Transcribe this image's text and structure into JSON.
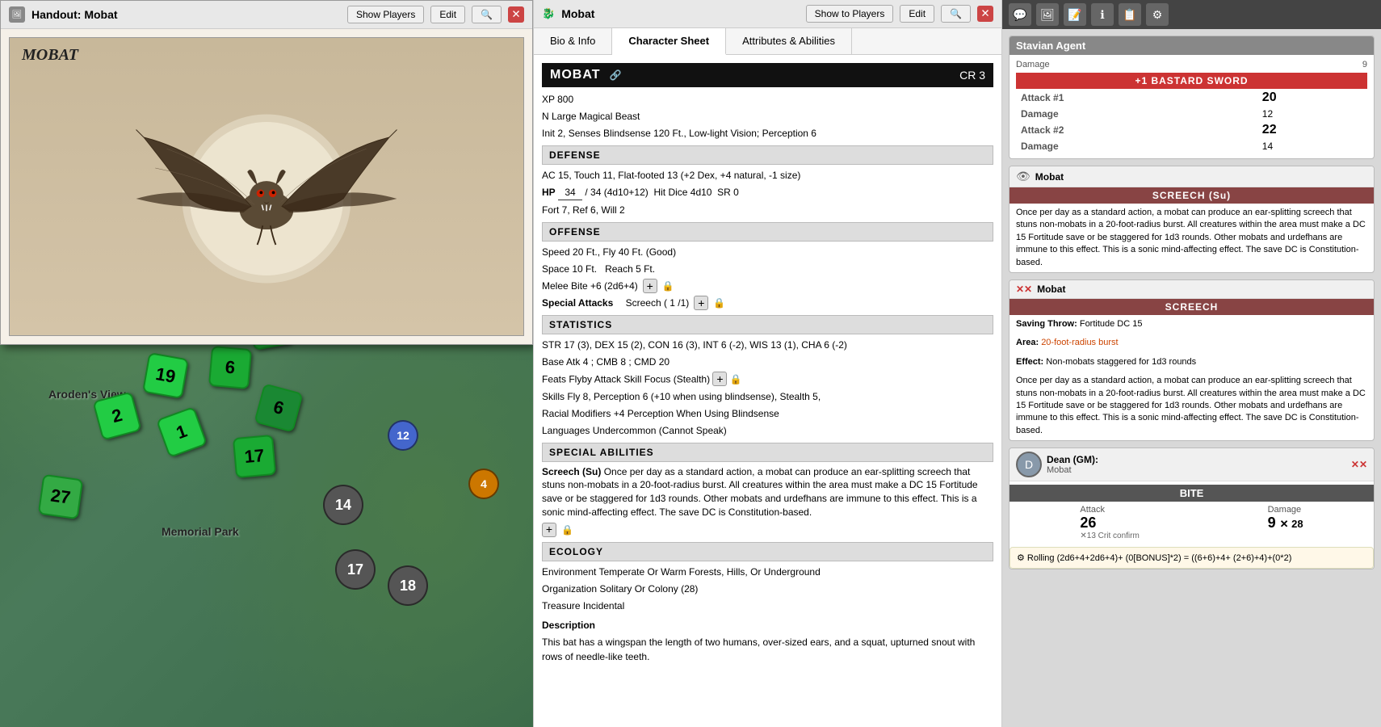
{
  "handout": {
    "title": "Handout: Mobat",
    "show_players_label": "Show Players",
    "edit_label": "Edit",
    "search_icon": "🔍",
    "image_title": "MOBAT",
    "image_alt": "Mobat - large bat creature"
  },
  "char_panel": {
    "title": "Mobat",
    "show_to_players_label": "Show to Players",
    "edit_label": "Edit",
    "search_icon": "🔍",
    "tabs": [
      {
        "id": "bio",
        "label": "Bio & Info"
      },
      {
        "id": "sheet",
        "label": "Character Sheet",
        "active": true
      },
      {
        "id": "attrs",
        "label": "Attributes & Abilities"
      }
    ],
    "creature": {
      "name": "MOBAT",
      "cr": "CR 3",
      "xp": "XP 800",
      "type": "N Large Magical Beast",
      "init": "Init 2",
      "senses": "Senses Blindsense 120 Ft., Low-light Vision; Perception 6",
      "defense_header": "DEFENSE",
      "ac": "AC 15, Touch 11, Flat-footed 13 (+2 Dex, +4 natural, -1 size)",
      "hp_label": "HP",
      "hp_current": "34",
      "hp_max": "34 (4d10+12)",
      "hit_dice": "Hit Dice 4d10",
      "sr": "SR 0",
      "fort": "Fort 7",
      "ref": "Ref 6",
      "will": "Will 2",
      "offense_header": "OFFENSE",
      "speed": "Speed 20 Ft., Fly 40 Ft. (Good)",
      "space": "Space 10 Ft.",
      "reach": "Reach 5 Ft.",
      "melee": "Melee    Bite +6 (2d6+4)",
      "special_attacks_label": "Special Attacks",
      "special_attacks_value": "Screech ( 1 /1)",
      "statistics_header": "STATISTICS",
      "str": "STR 17 (3)",
      "dex": "DEX 15 (2)",
      "con": "CON 16 (3)",
      "int": "INT 6 (-2)",
      "wis": "WIS 13 (1)",
      "cha": "CHA 6 (-2)",
      "base_atk": "Base Atk 4",
      "cmb": "CMB 8",
      "cmd": "CMD 20",
      "feats": "Feats    Flyby Attack   Skill Focus (Stealth)",
      "skills": "Skills Fly 8, Perception 6 (+10 when using blindsense), Stealth 5,",
      "racial_mod": "Racial Modifiers +4 Perception When Using Blindsense",
      "languages": "Languages Undercommon (Cannot Speak)",
      "special_abilities_header": "SPECIAL ABILITIES",
      "screech_text": "Screech (Su) Once per day as a standard action, a mobat can produce an ear-splitting screech that stuns non-mobats in a 20-foot-radius burst. All creatures within the area must make a DC 15 Fortitude save or be staggered for 1d3 rounds. Other mobats and urdefhans are immune to this effect. This is a sonic mind-affecting effect. The save DC is Constitution-based.",
      "ecology_header": "ECOLOGY",
      "environment": "Environment Temperate Or Warm Forests, Hills, Or Underground",
      "organization": "Organization Solitary Or Colony (28)",
      "treasure": "Treasure Incidental",
      "description_header": "Description",
      "description": "This bat has a wingspan the length of two humans, over-sized ears, and a squat, upturned snout with rows of needle-like teeth."
    }
  },
  "right_panel": {
    "toolbar_icons": [
      "chat",
      "image",
      "text",
      "info",
      "list-check",
      "settings"
    ],
    "stavian_section": {
      "agent_label": "Stavian Agent",
      "sword_title": "+1 BASTARD SWORD",
      "damage_label": "Damage",
      "damage_val": "9",
      "attack1_label": "Attack #1",
      "attack1_val": "20",
      "damage1_label": "Damage",
      "damage1_val": "12",
      "attack2_label": "Attack #2",
      "attack2_val": "22",
      "damage2_label": "Damage",
      "damage2_val": "14"
    },
    "mobat_screech": {
      "sender": "Mobat",
      "screech_title": "SCREECH (Su)",
      "screech_body": "Once per day as a standard action, a mobat can produce an ear-splitting screech that stuns non-mobats in a 20-foot-radius burst. All creatures within the area must make a DC 15 Fortitude save or be staggered for 1d3 rounds. Other mobats and urdefhans are immune to this effect. This is a sonic mind-affecting effect. The save DC is Constitution-based.",
      "screech2_title": "SCREECH",
      "save_throw": "Saving Throw: Fortitude DC 15",
      "area": "Area: 20-foot-radius burst",
      "effect": "Effect: Non-mobats staggered for 1d3 rounds",
      "screech2_body": "Once per day as a standard action, a mobat can produce an ear-splitting screech that stuns non-mobats in a 20-foot-radius burst. All creatures within the area must make a DC 15 Fortitude save or be staggered for 1d3 rounds. Other mobats and urdefhans are immune to this effect. This is a sonic mind-affecting effect. The save DC is Constitution-based."
    },
    "dean_section": {
      "sender": "Dean (GM):",
      "entity": "Mobat",
      "bite_title": "BITE",
      "attack_label": "Attack",
      "attack_val": "26",
      "crit_label": "✕13 Crit confirm",
      "damage_label": "Damage",
      "damage_val": "9",
      "damage_suffix": "✕ 28"
    },
    "roll_result": {
      "text": "⚙ Rolling (2d6+4+2d6+4)+ (0[BONUS]*2) = ((6+6)+4+ (2+6)+4)+(0*2)"
    }
  }
}
